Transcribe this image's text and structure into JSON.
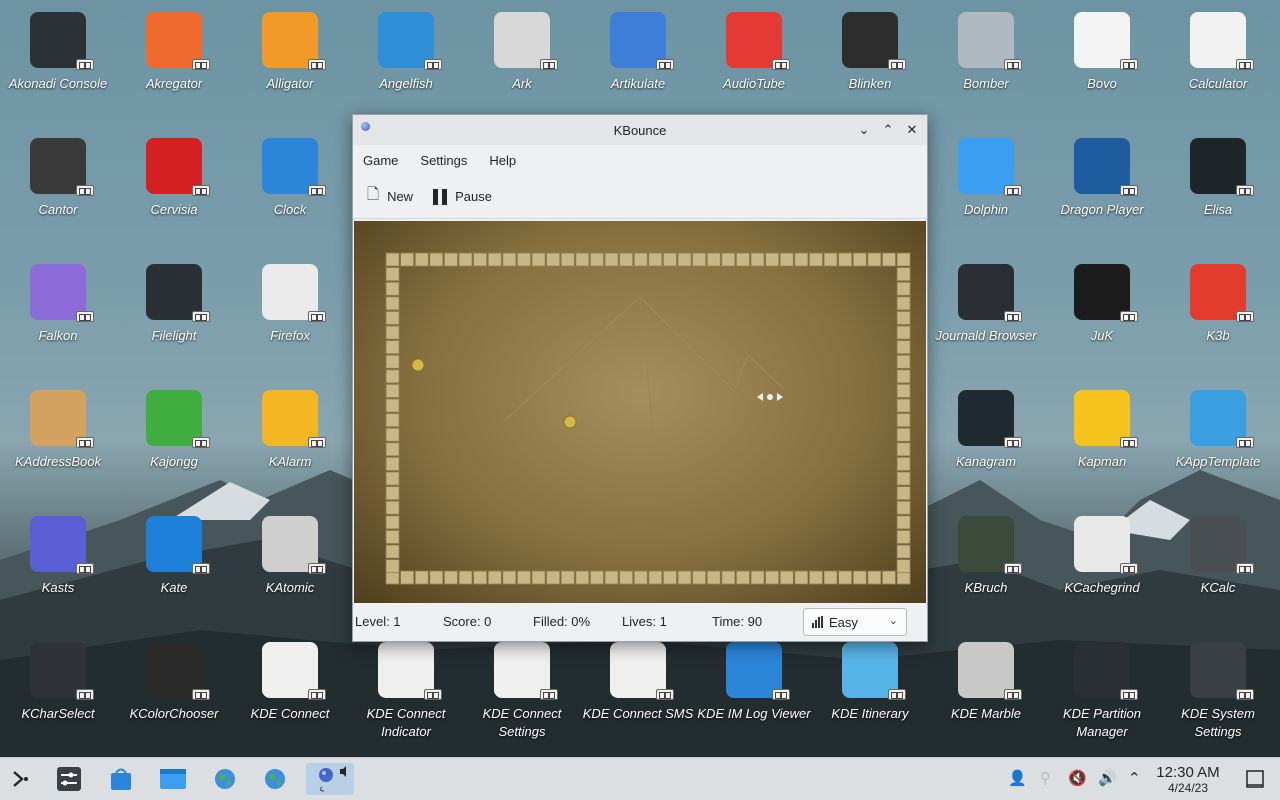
{
  "desktop": {
    "icons": [
      {
        "label": "Akonadi Console",
        "icon": "terminal-icon",
        "color": "#2c3136"
      },
      {
        "label": "Akregator",
        "icon": "rss-icon",
        "color": "#f06a2e"
      },
      {
        "label": "Alligator",
        "icon": "alligator-icon",
        "color": "#f29a28"
      },
      {
        "label": "Angelfish",
        "icon": "angelfish-icon",
        "color": "#2f8fd6"
      },
      {
        "label": "Ark",
        "icon": "zip-archive-icon",
        "color": "#d8d8d8"
      },
      {
        "label": "Artikulate",
        "icon": "artikulate-icon",
        "color": "#3d7fd8"
      },
      {
        "label": "AudioTube",
        "icon": "audiotube-icon",
        "color": "#e53935"
      },
      {
        "label": "Blinken",
        "icon": "blinken-icon",
        "color": "#2d2d2d"
      },
      {
        "label": "Bomber",
        "icon": "bomber-icon",
        "color": "#b0b8c0"
      },
      {
        "label": "Bovo",
        "icon": "bovo-icon",
        "color": "#f4f4f4"
      },
      {
        "label": "Calculator",
        "icon": "calculator-icon",
        "color": "#f2f2f2"
      },
      {
        "label": "Cantor",
        "icon": "cantor-icon",
        "color": "#3a3a3a"
      },
      {
        "label": "Cervisia",
        "icon": "cervisia-icon",
        "color": "#d42020"
      },
      {
        "label": "Clock",
        "icon": "clock-icon",
        "color": "#2b86d9"
      },
      {
        "label": "Dolphin",
        "icon": "folder-icon",
        "color": "#3a9ff0"
      },
      {
        "label": "Dragon Player",
        "icon": "dragon-player-icon",
        "color": "#1c5c9e"
      },
      {
        "label": "Elisa",
        "icon": "elisa-icon",
        "color": "#1f2629"
      },
      {
        "label": "Falkon",
        "icon": "falkon-icon",
        "color": "#8c6bd8"
      },
      {
        "label": "Filelight",
        "icon": "filelight-icon",
        "color": "#2a2f33"
      },
      {
        "label": "Firefox",
        "icon": "file-icon",
        "color": "#eaeaea"
      },
      {
        "label": "Journald Browser",
        "icon": "journald-icon",
        "color": "#2a2e33"
      },
      {
        "label": "JuK",
        "icon": "juk-icon",
        "color": "#1c1c1c"
      },
      {
        "label": "K3b",
        "icon": "k3b-icon",
        "color": "#e33b2e"
      },
      {
        "label": "KAddressBook",
        "icon": "addressbook-icon",
        "color": "#d4a25f"
      },
      {
        "label": "Kajongg",
        "icon": "kajongg-icon",
        "color": "#3fae3f"
      },
      {
        "label": "KAlarm",
        "icon": "bell-icon",
        "color": "#f5b623"
      },
      {
        "label": "Kanagram",
        "icon": "kanagram-icon",
        "color": "#1f2a30"
      },
      {
        "label": "Kapman",
        "icon": "kapman-icon",
        "color": "#f6c21c"
      },
      {
        "label": "KAppTemplate",
        "icon": "kapptemplate-icon",
        "color": "#3a9fe0"
      },
      {
        "label": "Kasts",
        "icon": "kasts-icon",
        "color": "#5b5fd6"
      },
      {
        "label": "Kate",
        "icon": "kate-icon",
        "color": "#1d7fd8"
      },
      {
        "label": "KAtomic",
        "icon": "katomic-icon",
        "color": "#cfcfcf"
      },
      {
        "label": "KBruch",
        "icon": "kbruch-icon",
        "color": "#3b4a3a"
      },
      {
        "label": "KCachegrind",
        "icon": "kcachegrind-icon",
        "color": "#e8e8e8"
      },
      {
        "label": "KCalc",
        "icon": "kcalc-icon",
        "color": "#4a4f54"
      },
      {
        "label": "KCharSelect",
        "icon": "kcharselect-icon",
        "color": "#2f3338"
      },
      {
        "label": "KColorChooser",
        "icon": "kcolorchooser-icon",
        "color": "#2a2a2a"
      },
      {
        "label": "KDE Connect",
        "icon": "kdeconnect-icon",
        "color": "#f0f0f0"
      },
      {
        "label": "KDE Connect Indicator",
        "icon": "kdeconnect-icon",
        "color": "#f0f0f0"
      },
      {
        "label": "KDE Connect Settings",
        "icon": "kdeconnect-icon",
        "color": "#f0f0f0"
      },
      {
        "label": "KDE Connect SMS",
        "icon": "kdeconnect-icon",
        "color": "#f0f0f0"
      },
      {
        "label": "KDE IM Log Viewer",
        "icon": "chat-log-icon",
        "color": "#2b86d9"
      },
      {
        "label": "KDE Itinerary",
        "icon": "plane-icon",
        "color": "#58b4e8"
      },
      {
        "label": "KDE Marble",
        "icon": "marble-icon",
        "color": "#c8c8c8"
      },
      {
        "label": "KDE Partition Manager",
        "icon": "partition-icon",
        "color": "#2a2f33"
      },
      {
        "label": "KDE System Settings",
        "icon": "settings-icon",
        "color": "#3a3f44"
      }
    ]
  },
  "window": {
    "title": "KBounce",
    "menu": [
      "Game",
      "Settings",
      "Help"
    ],
    "toolbar": {
      "new_label": "New",
      "pause_label": "Pause"
    },
    "status": {
      "level": "Level: 1",
      "score": "Score: 0",
      "filled": "Filled: 0%",
      "lives": "Lives: 1",
      "time": "Time: 90",
      "difficulty": "Easy"
    }
  },
  "taskbar": {
    "time": "12:30 AM",
    "date": "4/24/23"
  }
}
